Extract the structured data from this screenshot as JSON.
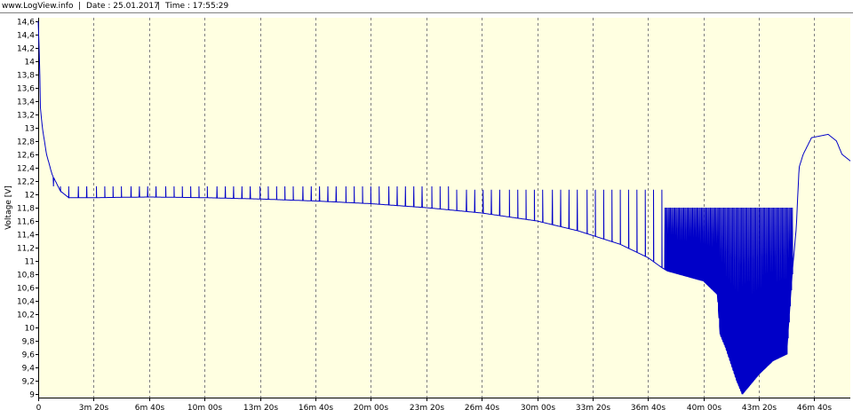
{
  "header": {
    "site": "www.LogView.info",
    "sep1": "|",
    "date": "Date : 25.01.2017",
    "sep2": "|",
    "time": "Time : 17:55:29"
  },
  "colors": {
    "plot_background": "#ffffe1",
    "series_line": "#0000c8",
    "grid": "#808080",
    "axis": "#000000"
  },
  "chart_data": {
    "type": "line",
    "title": "",
    "xlabel": "",
    "ylabel": "Voltage [V]",
    "x_unit": "seconds",
    "xlim": [
      0,
      2930
    ],
    "ylim": [
      8.95,
      14.65
    ],
    "grid": "vertical dashed",
    "y_ticks": [
      9,
      9.2,
      9.4,
      9.6,
      9.8,
      10,
      10.2,
      10.4,
      10.6,
      10.8,
      11,
      11.2,
      11.4,
      11.6,
      11.8,
      12,
      12.2,
      12.4,
      12.6,
      12.8,
      13,
      13.2,
      13.4,
      13.6,
      13.8,
      14,
      14.2,
      14.4,
      14.6
    ],
    "y_tick_labels": [
      "9",
      "9,2",
      "9,4",
      "9,6",
      "9,8",
      "10",
      "10,2",
      "10,4",
      "10,6",
      "10,8",
      "11",
      "11,2",
      "11,4",
      "11,6",
      "11,8",
      "12",
      "12,2",
      "12,4",
      "12,6",
      "12,8",
      "13",
      "13,2",
      "13,4",
      "13,6",
      "13,8",
      "14",
      "14,2",
      "14,4",
      "14,6"
    ],
    "x_ticks": [
      0,
      200,
      400,
      600,
      800,
      1000,
      1200,
      1400,
      1600,
      1800,
      2000,
      2200,
      2400,
      2600,
      2800
    ],
    "x_tick_labels": [
      "0",
      "3m 20s",
      "6m 40s",
      "10m 00s",
      "13m 20s",
      "16m 40s",
      "20m 00s",
      "23m 20s",
      "26m 40s",
      "30m 00s",
      "33m 20s",
      "36m 40s",
      "40m 00s",
      "43m 20s",
      "46m 40s"
    ],
    "series": [
      {
        "name": "",
        "points": [
          [
            0,
            14.6
          ],
          [
            5,
            14.0
          ],
          [
            8,
            13.3
          ],
          [
            15,
            13.0
          ],
          [
            30,
            12.6
          ],
          [
            50,
            12.3
          ],
          [
            80,
            12.05
          ],
          [
            110,
            11.95
          ],
          [
            200,
            11.95
          ],
          [
            400,
            11.96
          ],
          [
            600,
            11.95
          ],
          [
            800,
            11.93
          ],
          [
            1000,
            11.9
          ],
          [
            1200,
            11.86
          ],
          [
            1400,
            11.8
          ],
          [
            1600,
            11.72
          ],
          [
            1800,
            11.6
          ],
          [
            1950,
            11.45
          ],
          [
            2100,
            11.25
          ],
          [
            2200,
            11.05
          ],
          [
            2250,
            10.9
          ],
          [
            2270,
            10.85
          ],
          [
            2400,
            10.7
          ],
          [
            2450,
            10.5
          ],
          [
            2460,
            9.9
          ],
          [
            2480,
            9.7
          ],
          [
            2520,
            9.2
          ],
          [
            2540,
            9.0
          ],
          [
            2600,
            9.3
          ],
          [
            2650,
            9.5
          ],
          [
            2700,
            9.6
          ],
          [
            2720,
            10.8
          ],
          [
            2735,
            11.5
          ],
          [
            2745,
            12.4
          ],
          [
            2760,
            12.6
          ],
          [
            2790,
            12.85
          ],
          [
            2850,
            12.9
          ],
          [
            2880,
            12.8
          ],
          [
            2900,
            12.6
          ],
          [
            2930,
            12.5
          ]
        ],
        "spike_times": [
          55,
          80,
          110,
          145,
          175,
          210,
          240,
          270,
          300,
          335,
          365,
          395,
          425,
          460,
          490,
          520,
          550,
          580,
          610,
          645,
          675,
          705,
          735,
          765,
          800,
          830,
          860,
          890,
          920,
          955,
          985,
          1015,
          1045,
          1075,
          1110,
          1140,
          1170,
          1200,
          1230,
          1265,
          1295,
          1325,
          1355,
          1385,
          1420,
          1450,
          1480,
          1510,
          1545,
          1575,
          1605,
          1635,
          1665,
          1700,
          1730,
          1760,
          1790,
          1820,
          1855,
          1885,
          1915,
          1945,
          1980,
          2010,
          2040,
          2070,
          2100,
          2130,
          2160,
          2190,
          2220,
          2250
        ],
        "spike_peak": [
          12.12
        ],
        "oscillation_range": [
          2260,
          2720
        ],
        "oscillation_high": 11.8
      }
    ]
  }
}
